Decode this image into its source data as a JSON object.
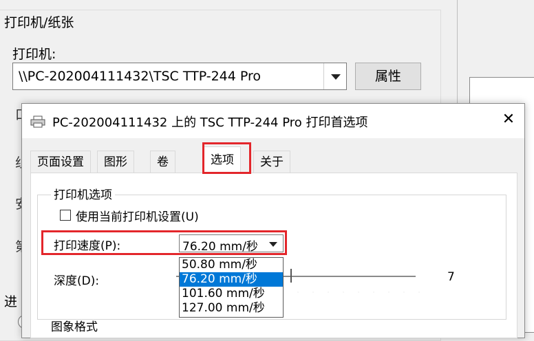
{
  "background_dialog": {
    "group_title": "打印机/纸张",
    "printer_label": "打印机:",
    "printer_name": "\\\\PC-202004111432\\TSC TTP-244 Pro",
    "properties_button": "属性",
    "left_chars": [
      "口",
      "组",
      "安",
      "第"
    ],
    "bottom_label": "进"
  },
  "dialog": {
    "title": "PC-202004111432 上的 TSC TTP-244 Pro 打印首选项",
    "close_label": "✕",
    "tabs": [
      "页面设置",
      "图形",
      "卷",
      "选项",
      "关于"
    ],
    "active_tab": "选项",
    "printer_options": {
      "group_title": "打印机选项",
      "use_current_settings": "使用当前打印机设置(U)",
      "use_current_checked": false,
      "speed_label": "打印速度(P):",
      "speed_value": "76.20 mm/秒",
      "speed_options": [
        "50.80 mm/秒",
        "76.20 mm/秒",
        "101.60 mm/秒",
        "127.00 mm/秒"
      ],
      "speed_selected_index": 1,
      "depth_label": "深度(D):",
      "depth_max": "7",
      "next_group_title": "图象格式"
    }
  },
  "colors": {
    "highlight_border": "#e3262b",
    "selection": "#0078d7"
  }
}
